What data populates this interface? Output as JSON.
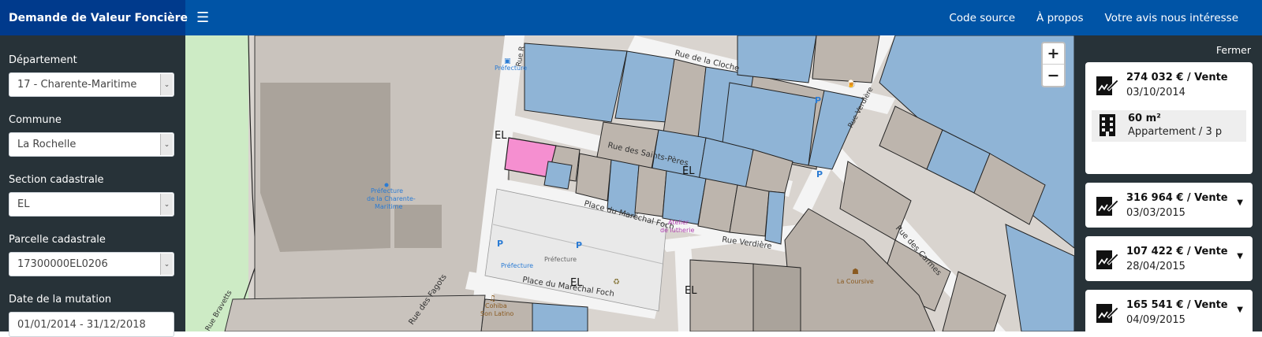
{
  "header": {
    "brand": "Demande de Valeur Foncière",
    "menu_icon": "hamburger-icon",
    "links": [
      "Code source",
      "À propos",
      "Votre avis nous intéresse"
    ]
  },
  "sidebar": {
    "departement_label": "Département",
    "departement_value": "17 - Charente-Maritime",
    "commune_label": "Commune",
    "commune_value": "La Rochelle",
    "section_label": "Section cadastrale",
    "section_value": "EL",
    "parcelle_label": "Parcelle cadastrale",
    "parcelle_value": "17300000EL0206",
    "date_label": "Date de la mutation",
    "date_value": "01/01/2014 - 31/12/2018"
  },
  "map": {
    "zoom_in": "+",
    "zoom_out": "−",
    "labels": {
      "rue_cloche": "Rue de la Cloche",
      "rue_saints_peres": "Rue des Saints-Pères",
      "place_foch_1": "Place du Maréchal Foch",
      "place_foch_2": "Place du Maréchal Foch",
      "rue_verdiere_1": "Rue Verdière",
      "rue_verdiere_2": "Rue Verdière",
      "rue_carmes": "Rue des Carmes",
      "rue_fagots": "Rue des Fagots",
      "rue_r": "Rue R",
      "rue_bravetts": "Rue Bravetts",
      "section_el_1": "EL",
      "section_el_2": "EL",
      "section_el_3": "EL",
      "section_el_4": "EL",
      "prefecture_1": "Préfecture",
      "prefecture_2": "Préfecture",
      "prefecture_3": "Préfecture",
      "prefecture_charente_1": "Préfecture",
      "prefecture_charente_2": "de la Charente-",
      "prefecture_charente_3": "Maritime",
      "atelier_1": "Atelier",
      "atelier_2": "de lutherie",
      "la_coursive": "La Coursive",
      "cohiba_1": "Cohiba",
      "cohiba_2": "Son Latino"
    }
  },
  "panel": {
    "close_label": "Fermer",
    "sales": [
      {
        "price": "274 032 € / Vente",
        "date": "03/10/2014",
        "surface": "60 m²",
        "type": "Appartement / 3 p",
        "expanded": true
      },
      {
        "price": "316 964 € / Vente",
        "date": "03/03/2015",
        "expanded": false
      },
      {
        "price": "107 422 € / Vente",
        "date": "28/04/2015",
        "expanded": false
      },
      {
        "price": "165 541 € / Vente",
        "date": "04/09/2015",
        "expanded": false
      }
    ]
  },
  "colors": {
    "header_bg": "#0054a6",
    "brand_bg": "#003a8c",
    "sidebar_bg": "#273238",
    "parcel_blue": "#8fb4d6",
    "parcel_selected": "#f58fd0",
    "building_grey": "#bdb5ad"
  }
}
